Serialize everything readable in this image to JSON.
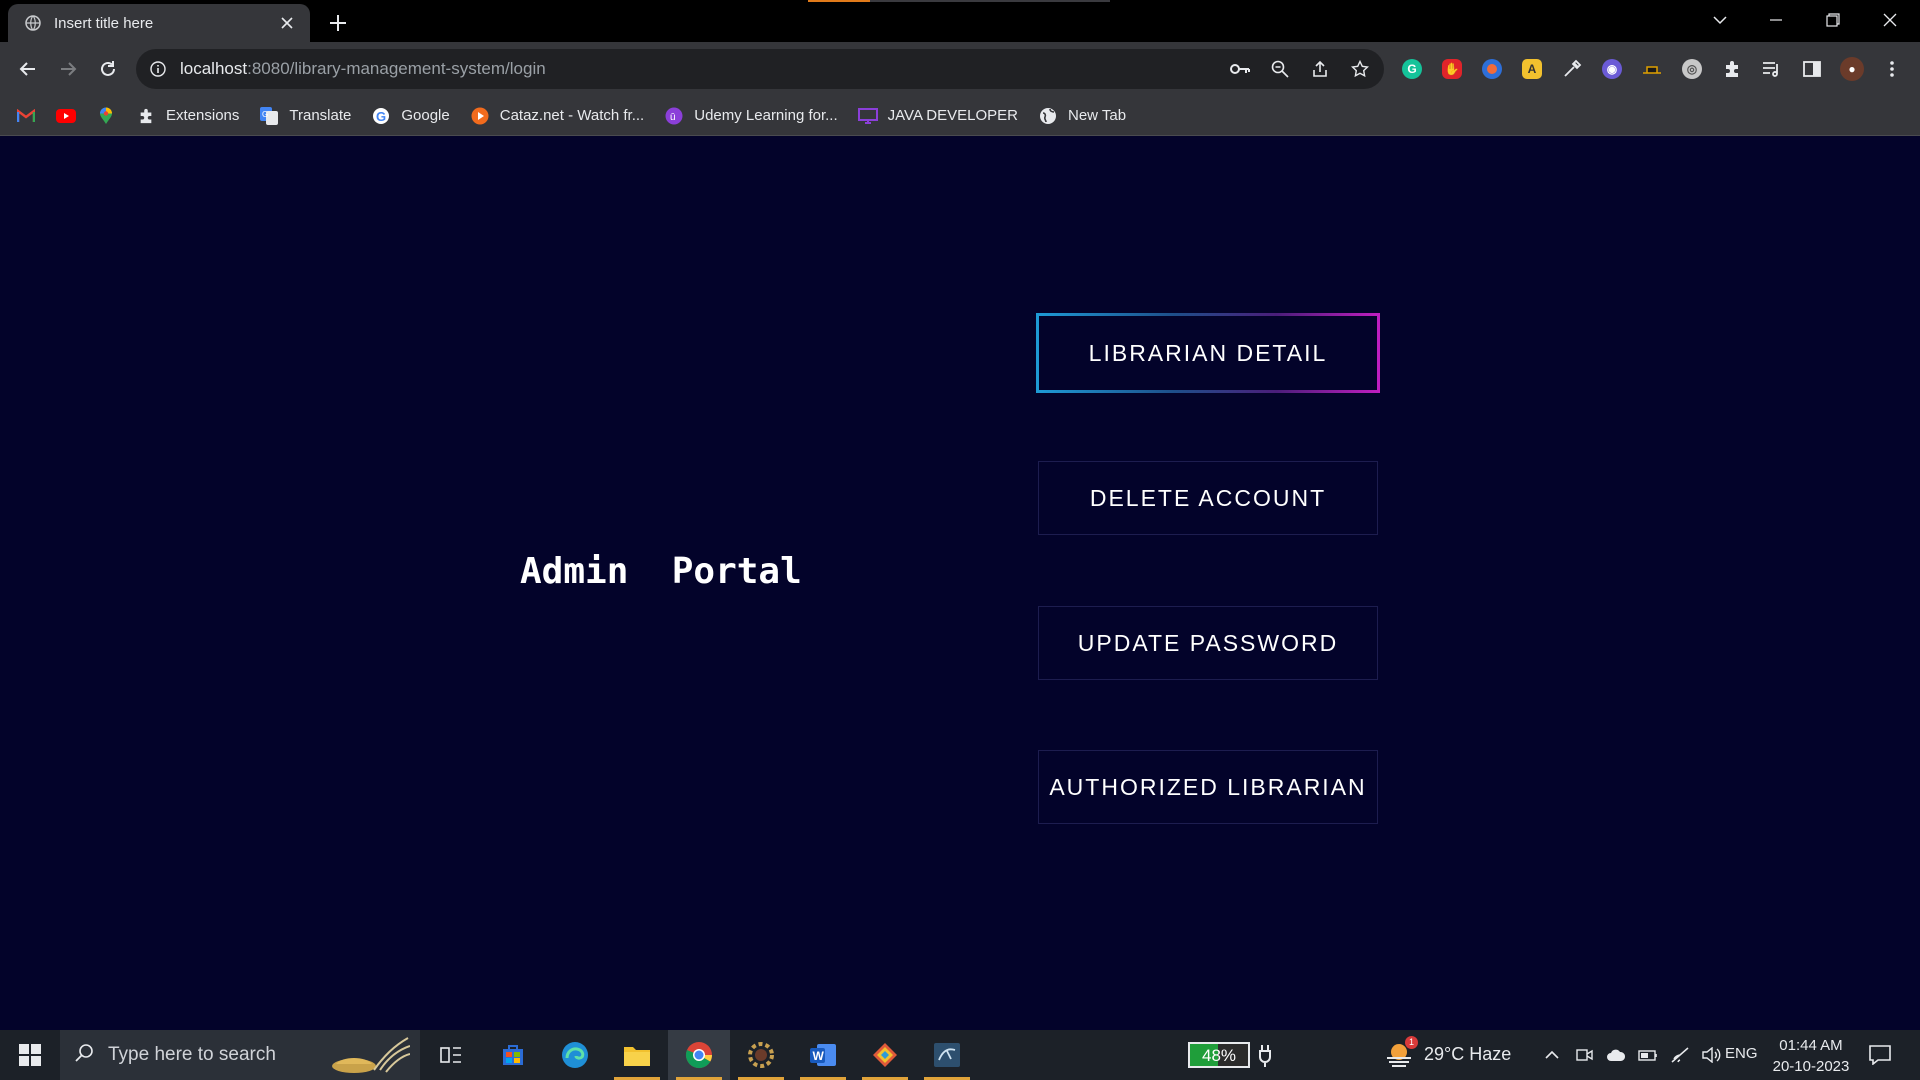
{
  "browser": {
    "tab_title": "Insert title here",
    "url_host": "localhost",
    "url_path": ":8080/library-management-system/login",
    "bookmarks": [
      {
        "label": "Extensions"
      },
      {
        "label": "Translate"
      },
      {
        "label": "Google"
      },
      {
        "label": "Cataz.net - Watch fr..."
      },
      {
        "label": "Udemy Learning for..."
      },
      {
        "label": "JAVA DEVELOPER"
      },
      {
        "label": "New Tab"
      }
    ]
  },
  "page": {
    "title": "Admin  Portal",
    "buttons": [
      {
        "label": "LIBRARIAN DETAIL",
        "state": "hover"
      },
      {
        "label": "DELETE ACCOUNT"
      },
      {
        "label": "UPDATE PASSWORD"
      },
      {
        "label": "AUTHORIZED LIBRARIAN"
      }
    ],
    "colors": {
      "background": "#03032a",
      "text": "#ffffff",
      "gradient_start": "#1e9bd6",
      "gradient_end": "#c01ec0"
    }
  },
  "taskbar": {
    "search_placeholder": "Type here to search",
    "battery_percent": "48%",
    "battery_level": 0.48,
    "weather": "29°C  Haze",
    "weather_badge": "1",
    "language": "ENG",
    "time": "01:44 AM",
    "date": "20-10-2023"
  }
}
